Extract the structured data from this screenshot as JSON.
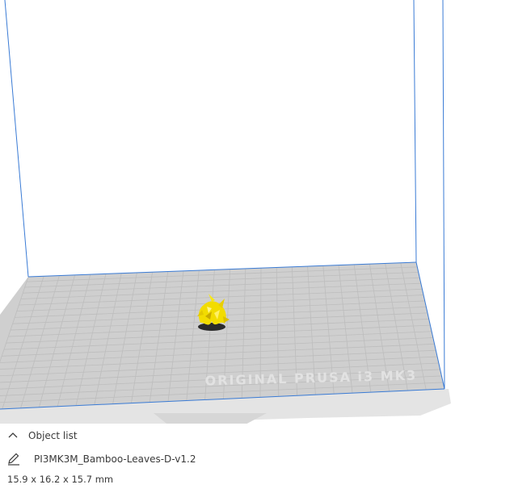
{
  "viewport": {
    "plate_watermark": "ORIGINAL PRUSA i3 MK3",
    "build_volume_color": "#3a7bd5",
    "model_color": "#f5e000",
    "plate_color": "#d0d0d0",
    "grid_color": "#bdbdbd"
  },
  "object_list": {
    "header_label": "Object list",
    "header_icon": "chevron-up-icon",
    "items": [
      {
        "name": "PI3MK3M_Bamboo-Leaves-D-v1.2",
        "icon": "pencil-edit-icon"
      }
    ],
    "dimensions": "15.9 x 16.2 x 15.7 mm"
  }
}
